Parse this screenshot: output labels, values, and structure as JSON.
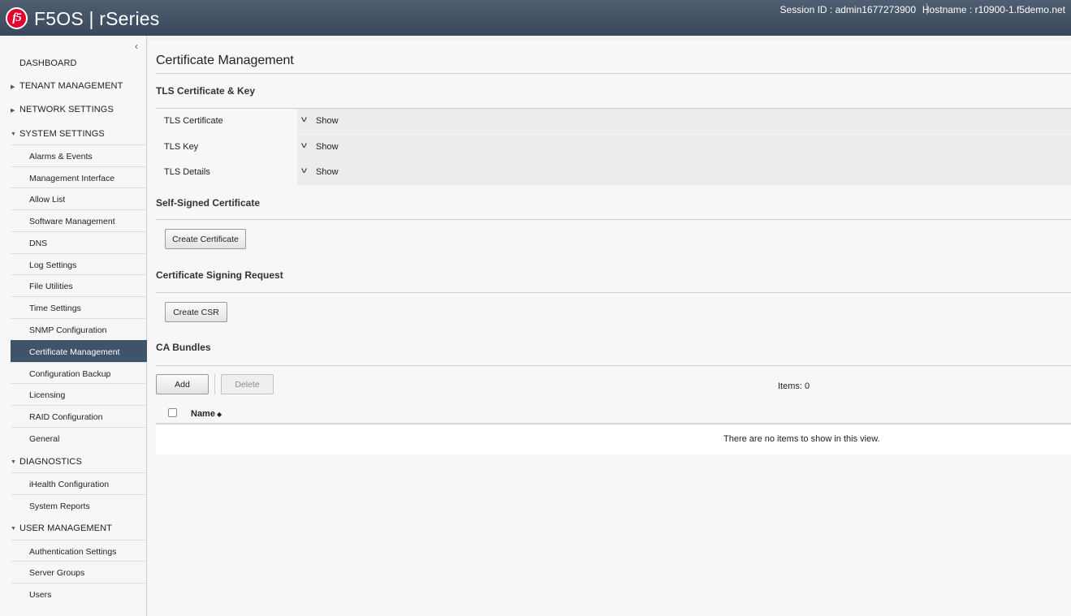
{
  "header": {
    "logo_text": "f5",
    "product": "F5OS | rSeries",
    "session": "Session ID : admin1677273900",
    "hostname": "Hostname : r10900-1.f5demo.net"
  },
  "sidebar": {
    "collapse_glyph": "‹",
    "dashboard": "DASHBOARD",
    "tenant_management": "TENANT MANAGEMENT",
    "network_settings": "NETWORK SETTINGS",
    "system_settings": "SYSTEM SETTINGS",
    "system_items": [
      "Alarms & Events",
      "Management Interface",
      "Allow List",
      "Software Management",
      "DNS",
      "Log Settings",
      "File Utilities",
      "Time Settings",
      "SNMP Configuration",
      "Certificate Management",
      "Configuration Backup",
      "Licensing",
      "RAID Configuration",
      "General"
    ],
    "diagnostics": "DIAGNOSTICS",
    "diagnostics_items": [
      "iHealth Configuration",
      "System Reports"
    ],
    "user_management": "USER MANAGEMENT",
    "user_items": [
      "Authentication Settings",
      "Server Groups",
      "Users"
    ]
  },
  "main": {
    "title": "Certificate Management",
    "tls_section": "TLS Certificate & Key",
    "tls_rows": [
      {
        "label": "TLS Certificate",
        "action": "Show"
      },
      {
        "label": "TLS Key",
        "action": "Show"
      },
      {
        "label": "TLS Details",
        "action": "Show"
      }
    ],
    "self_signed_section": "Self-Signed Certificate",
    "create_certificate": "Create Certificate",
    "csr_section": "Certificate Signing Request",
    "create_csr": "Create CSR",
    "ca_section": "CA Bundles",
    "add": "Add",
    "delete": "Delete",
    "items_count": "Items: 0",
    "col_name": "Name",
    "empty_text": "There are no items to show in this view."
  }
}
